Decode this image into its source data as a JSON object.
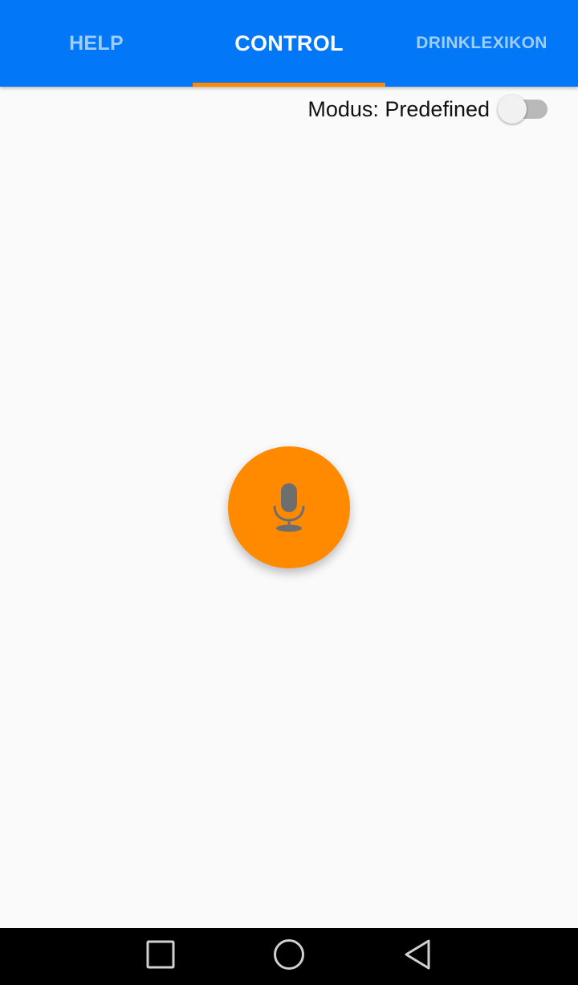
{
  "tabs": [
    {
      "label": "HELP",
      "active": false
    },
    {
      "label": "CONTROL",
      "active": true
    },
    {
      "label": "DRINKLEXIKON",
      "active": false
    }
  ],
  "mode": {
    "label": "Modus: Predefined",
    "switch_on": false
  },
  "mic_button": {
    "icon": "microphone-icon"
  },
  "navbar": {
    "recents_icon": "square-icon",
    "home_icon": "circle-icon",
    "back_icon": "triangle-back-icon"
  },
  "colors": {
    "primary": "#0277f7",
    "accent": "#ff8a00",
    "background": "#fafafa",
    "tab_inactive_text": "#9fcdfd",
    "navbar": "#000000"
  }
}
